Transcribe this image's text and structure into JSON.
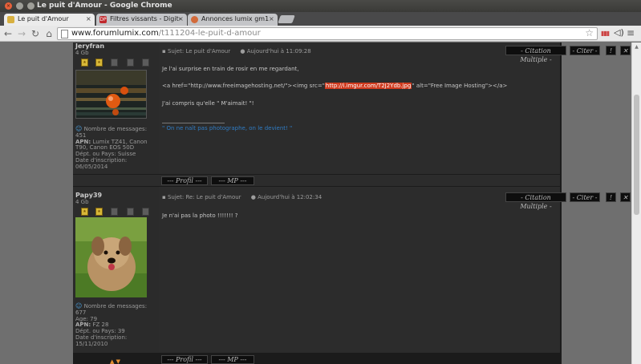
{
  "window": {
    "title": "Le puit d'Amour - Google Chrome"
  },
  "tabs": [
    {
      "label": "Le puit d'Amour",
      "icon_text": "",
      "active": true
    },
    {
      "label": "Filtres vissants - Digit-",
      "icon_text": "DP",
      "active": false
    },
    {
      "label": "Annonces lumix gm1",
      "icon_text": "",
      "active": false
    }
  ],
  "toolbar": {
    "url_host": "www.forumlumix.com",
    "url_path": "/t111204-le-puit-d-amour"
  },
  "posts": [
    {
      "username": "Jeryfran",
      "rank": "4 Gb",
      "messages_label": "Nombre de messages:",
      "messages": "451",
      "apn_label": "APN:",
      "apn": "Lumix TZ41, Canon T90, Canon EOS 50D",
      "country": "Dépt. ou Pays: Suisse",
      "joined": "Date d'inscription: 06/05/2014",
      "subject": "Sujet: Le puit d'Amour",
      "date": "Aujourd'hui à 11:09:28",
      "line1": "Je l'ai surprise en train de rosir en me regardant,",
      "line2_a": "<a href=\"http://www.freeimagehosting.net/\"><img src=\"",
      "line2_link": "http://i.imgur.com/T2J2Ydb.jpg",
      "line2_b": "\" alt=\"Free Image Hosting\"></a>",
      "line3": "J'ai compris qu'elle \" M'aimait! \"!",
      "signature": "\" On ne naît pas photographe, on le devient! \""
    },
    {
      "username": "Papy39",
      "rank": "4 Gb",
      "messages_label": "Nombre de messages:",
      "messages": "677",
      "age": "Age: 79",
      "apn_label": "APN:",
      "apn": "FZ 28",
      "country": "Dépt. ou Pays: 39",
      "joined": "Date d'inscription: 15/11/2010",
      "subject": "Sujet: Re: Le puit d'Amour",
      "date": "Aujourd'hui à 12:02:34",
      "line1": "Je n'ai pas la photo !!!!!!! ?"
    }
  ],
  "buttons": {
    "quote_multi": "- Citation Multiple -",
    "quote": "- Citer -",
    "alert": "!",
    "profile": "--- Profil ---",
    "pm": "--- MP ---",
    "arrows": "▲ ▼"
  }
}
